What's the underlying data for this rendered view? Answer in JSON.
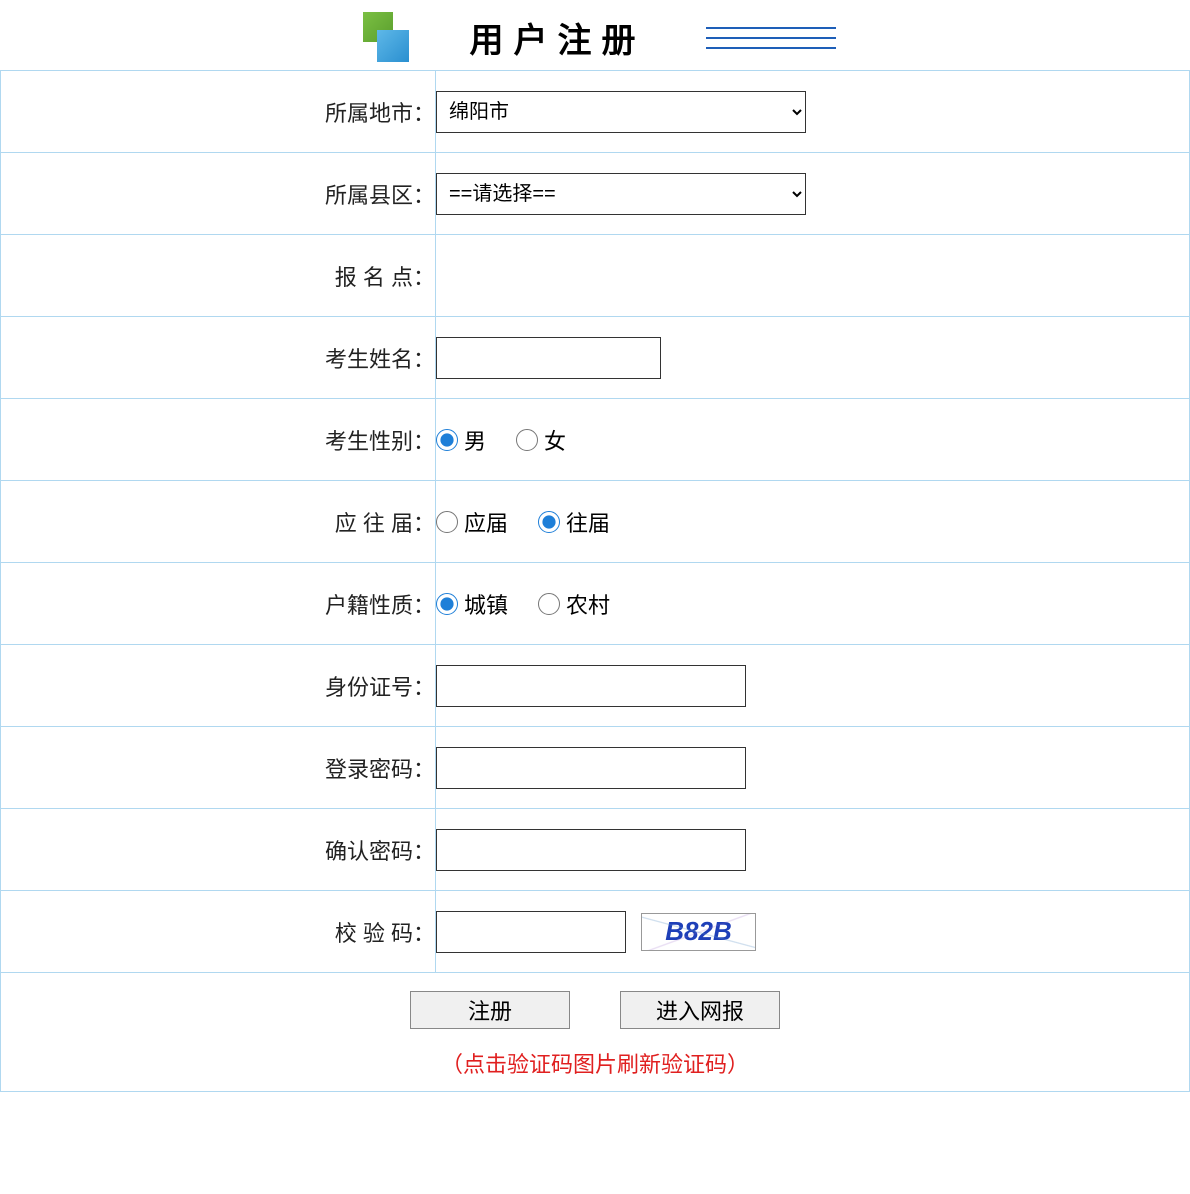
{
  "header": {
    "title": "用户注册"
  },
  "form": {
    "city": {
      "label": "所属地市：",
      "value": "绵阳市"
    },
    "district": {
      "label": "所属县区：",
      "value": "==请选择=="
    },
    "registration_point": {
      "label": "报 名 点："
    },
    "student_name": {
      "label": "考生姓名：",
      "value": ""
    },
    "gender": {
      "label": "考生性别：",
      "options": {
        "male": "男",
        "female": "女"
      }
    },
    "graduate_status": {
      "label": "应 往 届：",
      "options": {
        "current": "应届",
        "previous": "往届"
      }
    },
    "residence_type": {
      "label": "户籍性质：",
      "options": {
        "urban": "城镇",
        "rural": "农村"
      }
    },
    "id_number": {
      "label": "身份证号：",
      "value": ""
    },
    "password": {
      "label": "登录密码：",
      "value": ""
    },
    "confirm_password": {
      "label": "确认密码：",
      "value": ""
    },
    "captcha": {
      "label": "校 验 码：",
      "value": "",
      "image_text": "B82B"
    }
  },
  "buttons": {
    "register": "注册",
    "enter": "进入网报"
  },
  "hint": "（点击验证码图片刷新验证码）"
}
